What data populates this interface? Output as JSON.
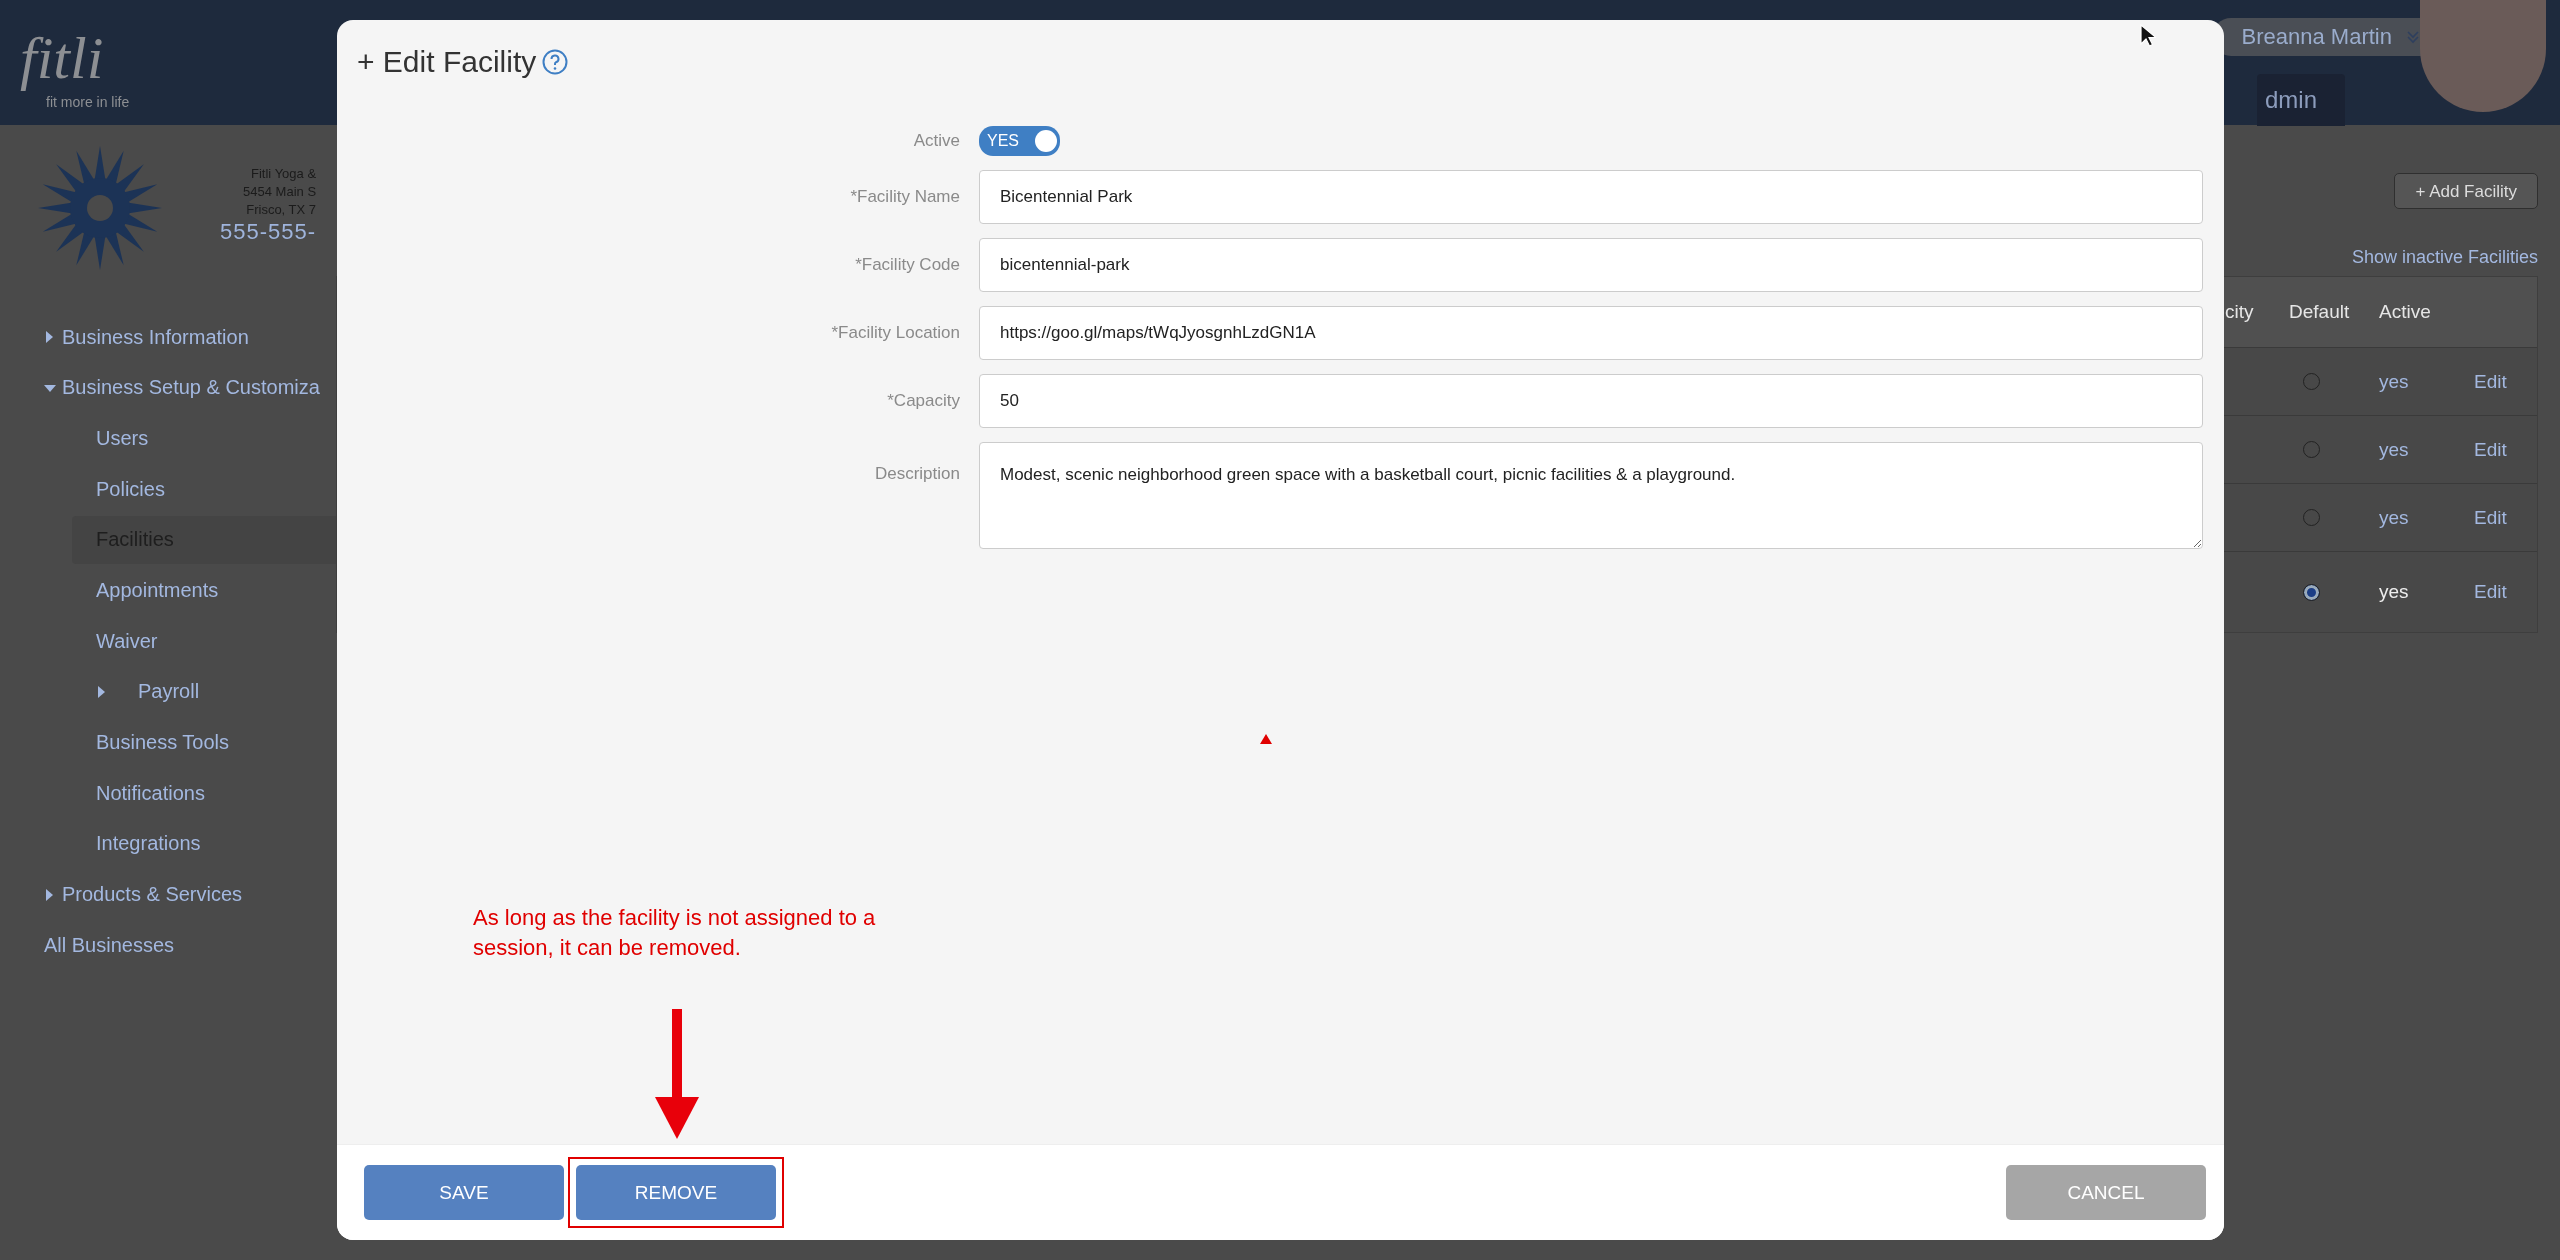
{
  "header": {
    "logo": "fitli",
    "tagline": "fit more in life",
    "user": "Breanna Martin",
    "tab": "dmin"
  },
  "business": {
    "lines": [
      "Fitli Yoga &",
      "5454 Main S",
      "Frisco, TX 7"
    ],
    "phone": "555-555-"
  },
  "sidebar": {
    "items": [
      {
        "label": "Business Information",
        "kind": "group",
        "expanded": false,
        "selected": false
      },
      {
        "label": "Business Setup & Customiza",
        "kind": "group",
        "expanded": true,
        "selected": false,
        "children": [
          {
            "label": "Users",
            "kind": "link",
            "selected": false
          },
          {
            "label": "Policies",
            "kind": "link",
            "selected": false
          },
          {
            "label": "Facilities",
            "kind": "link",
            "selected": true
          },
          {
            "label": "Appointments",
            "kind": "link",
            "selected": false
          },
          {
            "label": "Waiver",
            "kind": "link",
            "selected": false
          },
          {
            "label": "Payroll",
            "kind": "group",
            "expanded": false,
            "selected": false
          },
          {
            "label": "Business Tools",
            "kind": "link",
            "selected": false
          },
          {
            "label": "Notifications",
            "kind": "link",
            "selected": false
          },
          {
            "label": "Integrations",
            "kind": "link",
            "selected": false
          }
        ]
      },
      {
        "label": "Products & Services",
        "kind": "group",
        "expanded": false,
        "selected": false
      },
      {
        "label": "All Businesses",
        "kind": "link",
        "selected": false
      }
    ]
  },
  "main": {
    "add_button": "+ Add Facility",
    "show_inactive": "Show inactive Facilities",
    "table": {
      "columns": [
        "city",
        "Default",
        "Active"
      ],
      "rows": [
        {
          "default": false,
          "active": "yes",
          "active_linked": true,
          "edit": "Edit"
        },
        {
          "default": false,
          "active": "yes",
          "active_linked": true,
          "edit": "Edit"
        },
        {
          "default": false,
          "active": "yes",
          "active_linked": true,
          "edit": "Edit"
        },
        {
          "default": true,
          "active": "yes",
          "active_linked": false,
          "edit": "Edit"
        }
      ]
    }
  },
  "modal": {
    "title": "+ Edit Facility",
    "fields": [
      {
        "kind": "toggle",
        "label": "Active",
        "text": "YES",
        "on": true
      },
      {
        "kind": "text",
        "label": "*Facility Name",
        "value": "Bicentennial Park"
      },
      {
        "kind": "text",
        "label": "*Facility Code",
        "value": "bicentennial-park"
      },
      {
        "kind": "text",
        "label": "*Facility Location",
        "value": "https://goo.gl/maps/tWqJyosgnhLzdGN1A"
      },
      {
        "kind": "text",
        "label": "*Capacity",
        "value": "50"
      },
      {
        "kind": "textarea",
        "label": "Description",
        "value": "Modest, scenic neighborhood green space with a basketball court, picnic facilities & a playground."
      }
    ],
    "annotation": "As long as the facility is not assigned to a session, it can be removed.",
    "buttons": [
      {
        "label": "SAVE",
        "kind": "primary",
        "highlighted": false
      },
      {
        "label": "REMOVE",
        "kind": "primary",
        "highlighted": true
      },
      {
        "label": "CANCEL",
        "kind": "secondary",
        "highlighted": false
      }
    ]
  }
}
